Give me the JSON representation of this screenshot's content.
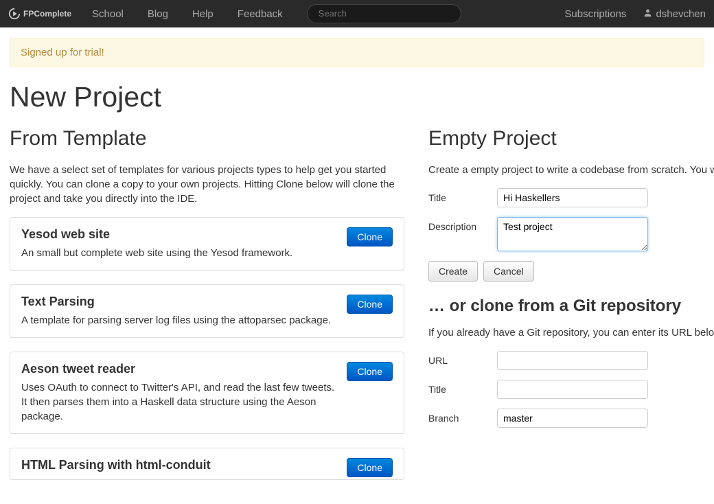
{
  "navbar": {
    "logo_text": "FPComplete",
    "links": [
      "School",
      "Blog",
      "Help",
      "Feedback"
    ],
    "search_placeholder": "Search",
    "subscriptions": "Subscriptions",
    "username": "dshevchen"
  },
  "alert": "Signed up for trial!",
  "page_title": "New Project",
  "template_section": {
    "heading": "From Template",
    "intro": "We have a select set of templates for various projects types to help get you started quickly. You can clone a copy to your own projects. Hitting Clone below will clone the project and take you directly into the IDE.",
    "clone_label": "Clone",
    "templates": [
      {
        "title": "Yesod web site",
        "desc": "An small but complete web site using the Yesod framework."
      },
      {
        "title": "Text Parsing",
        "desc": "A template for parsing server log files using the attoparsec package."
      },
      {
        "title": "Aeson tweet reader",
        "desc": "Uses OAuth to connect to Twitter's API, and read the last few tweets.\nIt then parses them into a Haskell data structure using the Aeson package."
      },
      {
        "title": "HTML Parsing with html-conduit",
        "desc": ""
      }
    ]
  },
  "empty_section": {
    "heading": "Empty Project",
    "intro": "Create a empty project to write a codebase from scratch. You will be taken directly into the IDE.",
    "title_label": "Title",
    "title_value": "Hi Haskellers",
    "desc_label": "Description",
    "desc_value": "Test project",
    "create_label": "Create",
    "cancel_label": "Cancel"
  },
  "git_section": {
    "heading": "… or clone from a Git repository",
    "intro": "If you already have a Git repository, you can enter its URL below and it will be cloned and you will be taken directly into the IDE.",
    "url_label": "URL",
    "title_label": "Title",
    "branch_label": "Branch",
    "branch_value": "master"
  }
}
